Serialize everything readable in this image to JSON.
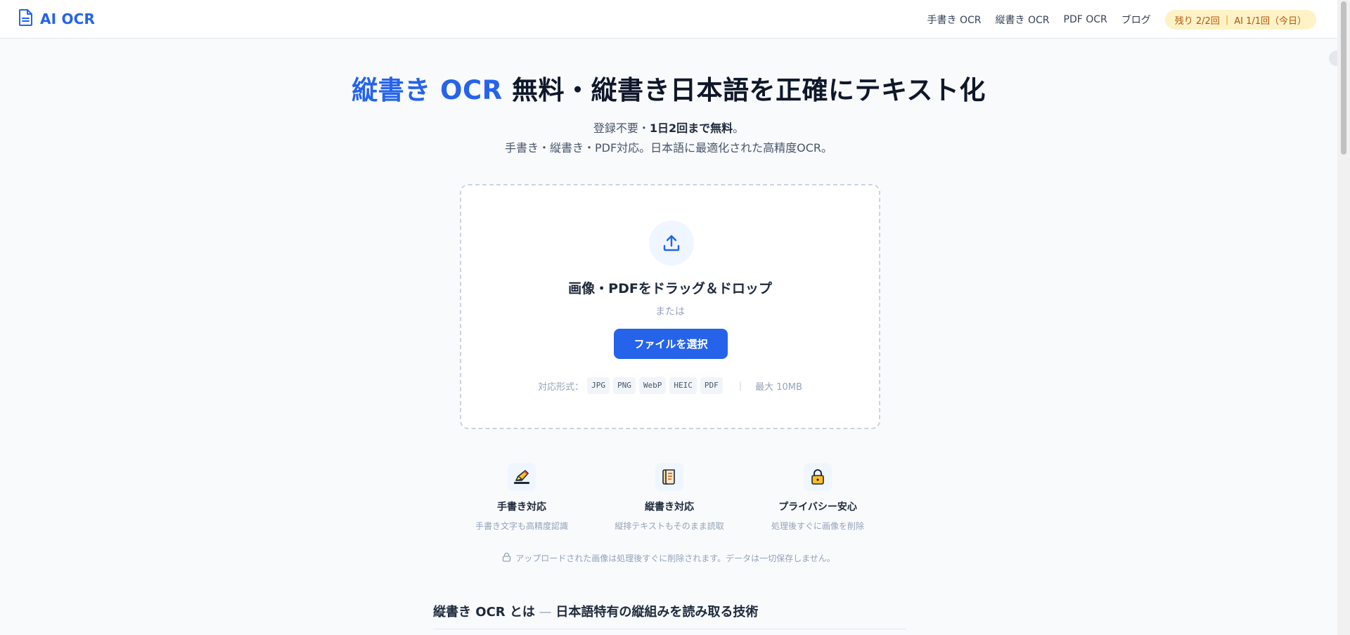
{
  "header": {
    "logo_text": "AI OCR",
    "logo_icon": "document-icon",
    "nav": [
      "手書き OCR",
      "縦書き OCR",
      "PDF OCR",
      "ブログ"
    ],
    "quota": {
      "remaining": "残り 2/2回",
      "ai": "AI 1/1回（今日）"
    }
  },
  "hero": {
    "title_accent": "縦書き OCR",
    "title_rest": " 無料・縦書き日本語を正確にテキスト化",
    "subtitle_plain": "登録不要・",
    "subtitle_bold": "1日2回まで無料",
    "subtitle_end": "。",
    "subtitle_2": "手書き・縦書き・PDF対応。日本語に最適化された高精度OCR。"
  },
  "upload": {
    "icon": "upload-icon",
    "drop_label": "画像・PDFをドラッグ＆ドロップ",
    "or_label": "または",
    "button_label": "ファイルを選択",
    "formats_label": "対応形式：",
    "formats": [
      "JPG",
      "PNG",
      "WebP",
      "HEIC",
      "PDF"
    ],
    "divider": "|",
    "max_size": "最大 10MB"
  },
  "features": [
    {
      "icon": "pencil-icon",
      "title": "手書き対応",
      "desc": "手書き文字も高精度認識"
    },
    {
      "icon": "scroll-icon",
      "title": "縦書き対応",
      "desc": "縦排テキストもそのまま読取"
    },
    {
      "icon": "lock-icon",
      "title": "プライバシー安心",
      "desc": "処理後すぐに画像を削除"
    }
  ],
  "privacy_note": "アップロードされた画像は処理後すぐに削除されます。データは一切保存しません。",
  "section": {
    "heading_main": "縦書き OCR とは",
    "heading_dash": " — ",
    "heading_sub": "日本語特有の縦組みを読み取る技術"
  },
  "colors": {
    "accent": "#2563eb",
    "badge_bg": "#fef3c7",
    "badge_text": "#b45309"
  }
}
